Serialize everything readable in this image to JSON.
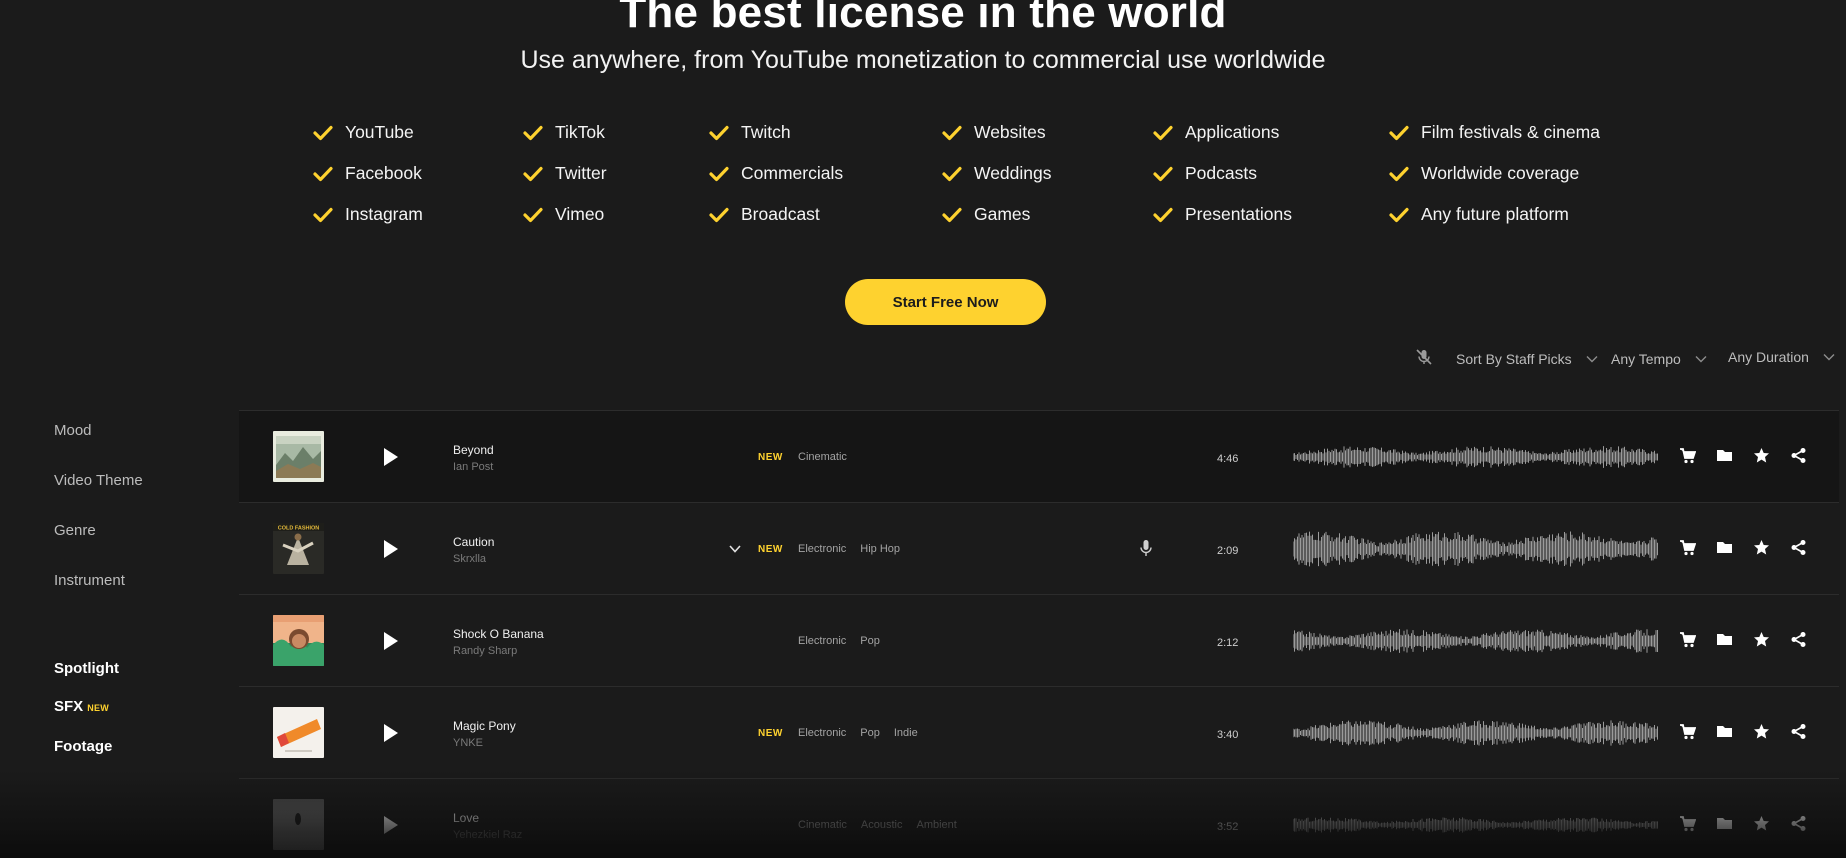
{
  "hero": {
    "title": "The best license in the world",
    "subtitle": "Use anywhere, from YouTube monetization to commercial use worldwide"
  },
  "features": [
    "YouTube",
    "TikTok",
    "Twitch",
    "Websites",
    "Applications",
    "Film festivals & cinema",
    "Facebook",
    "Twitter",
    "Commercials",
    "Weddings",
    "Podcasts",
    "Worldwide coverage",
    "Instagram",
    "Vimeo",
    "Broadcast",
    "Games",
    "Presentations",
    "Any future platform"
  ],
  "cta": {
    "label": "Start Free Now"
  },
  "filters": {
    "sort": "Sort By Staff Picks",
    "tempo": "Any Tempo",
    "duration": "Any Duration"
  },
  "sidebar": {
    "categories": [
      "Mood",
      "Video Theme",
      "Genre",
      "Instrument"
    ],
    "links": [
      {
        "label": "Spotlight",
        "badge": ""
      },
      {
        "label": "SFX",
        "badge": "NEW"
      },
      {
        "label": "Footage",
        "badge": ""
      }
    ]
  },
  "tracks": [
    {
      "title": "Beyond",
      "artist": "Ian Post",
      "new_label": "NEW",
      "tags": [
        "Cinematic"
      ],
      "duration": "4:46",
      "vocal": false
    },
    {
      "title": "Caution",
      "artist": "Skrxlla",
      "new_label": "NEW",
      "tags": [
        "Electronic",
        "Hip Hop"
      ],
      "duration": "2:09",
      "vocal": true
    },
    {
      "title": "Shock O Banana",
      "artist": "Randy Sharp",
      "new_label": "",
      "tags": [
        "Electronic",
        "Pop"
      ],
      "duration": "2:12",
      "vocal": false
    },
    {
      "title": "Magic Pony",
      "artist": "YNKE",
      "new_label": "NEW",
      "tags": [
        "Electronic",
        "Pop",
        "Indie"
      ],
      "duration": "3:40",
      "vocal": false
    },
    {
      "title": "Love",
      "artist": "Yehezkiel Raz",
      "new_label": "",
      "tags": [
        "Cinematic",
        "Acoustic",
        "Ambient"
      ],
      "duration": "3:52",
      "vocal": false
    }
  ],
  "colors": {
    "accent": "#fed22f",
    "background": "#1b1b1b",
    "row_featured": "#151515"
  }
}
